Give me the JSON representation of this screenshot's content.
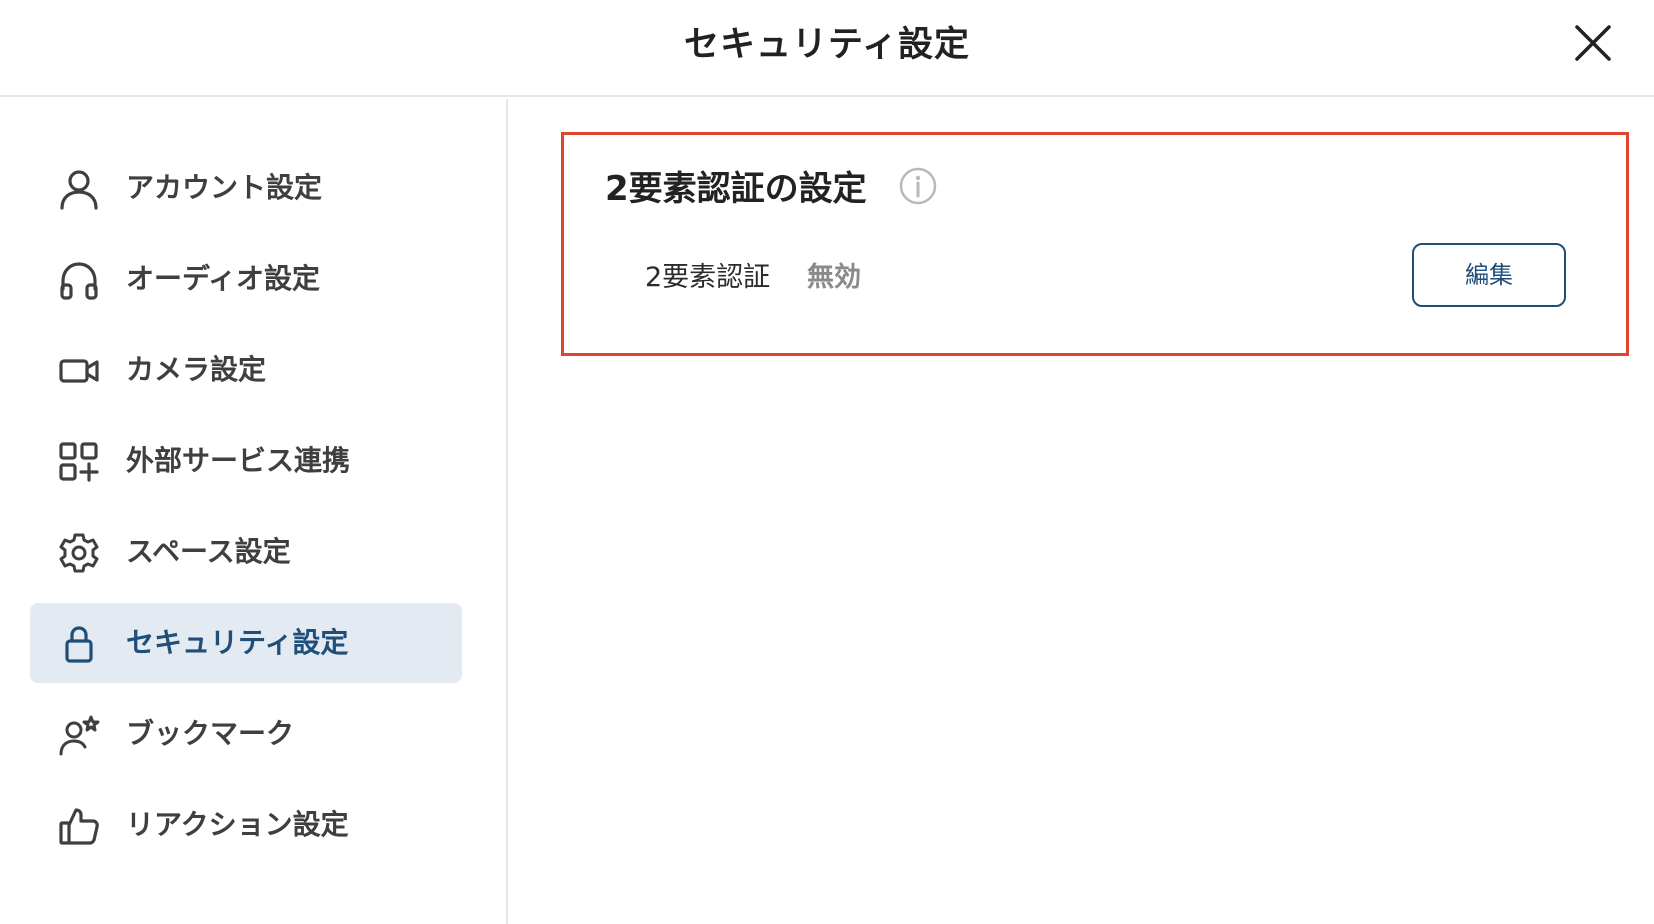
{
  "header": {
    "title": "セキュリティ設定",
    "close_icon": "close-icon"
  },
  "sidebar": {
    "items": [
      {
        "label": "アカウント設定",
        "icon": "user-icon",
        "active": false
      },
      {
        "label": "オーディオ設定",
        "icon": "headphones-icon",
        "active": false
      },
      {
        "label": "カメラ設定",
        "icon": "video-camera-icon",
        "active": false
      },
      {
        "label": "外部サービス連携",
        "icon": "apps-add-icon",
        "active": false
      },
      {
        "label": "スペース設定",
        "icon": "gear-icon",
        "active": false
      },
      {
        "label": "セキュリティ設定",
        "icon": "lock-icon",
        "active": true
      },
      {
        "label": "ブックマーク",
        "icon": "user-star-icon",
        "active": false
      },
      {
        "label": "リアクション設定",
        "icon": "thumbs-up-icon",
        "active": false
      }
    ]
  },
  "main": {
    "section": {
      "title": "2要素認証の設定",
      "info_icon": "info-icon",
      "setting_label": "2要素認証",
      "setting_status": "無効",
      "edit_label": "編集"
    }
  },
  "colors": {
    "accent": "#1f4e79",
    "active_bg": "#e3eaf2",
    "highlight_border": "#e0442e",
    "status_text": "#8a8a8a"
  }
}
